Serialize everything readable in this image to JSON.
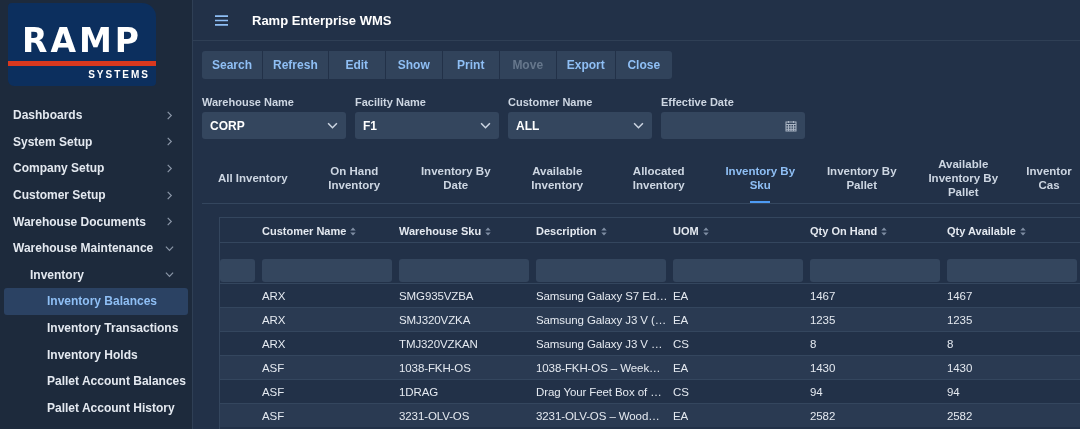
{
  "logo": {
    "name": "RAMP",
    "tagline": "SYSTEMS"
  },
  "sidebar": {
    "items": [
      {
        "label": "Dashboards",
        "expanded": false,
        "selected": false
      },
      {
        "label": "System Setup",
        "expanded": false,
        "selected": false
      },
      {
        "label": "Company Setup",
        "expanded": false,
        "selected": false
      },
      {
        "label": "Customer Setup",
        "expanded": false,
        "selected": false
      },
      {
        "label": "Warehouse Documents",
        "expanded": false,
        "selected": false
      },
      {
        "label": "Warehouse Maintenance",
        "expanded": true,
        "selected": false,
        "children": [
          {
            "label": "Inventory",
            "expanded": true,
            "selected": false,
            "children": [
              {
                "label": "Inventory Balances",
                "selected": true
              },
              {
                "label": "Inventory Transactions",
                "selected": false
              },
              {
                "label": "Inventory Holds",
                "selected": false
              },
              {
                "label": "Pallet Account Balances",
                "selected": false
              },
              {
                "label": "Pallet Account History",
                "selected": false
              }
            ]
          }
        ]
      }
    ]
  },
  "header": {
    "title": "Ramp Enterprise WMS"
  },
  "toolbar": [
    {
      "label": "Search",
      "disabled": false
    },
    {
      "label": "Refresh",
      "disabled": false
    },
    {
      "label": "Edit",
      "disabled": false
    },
    {
      "label": "Show",
      "disabled": false
    },
    {
      "label": "Print",
      "disabled": false
    },
    {
      "label": "Move",
      "disabled": true
    },
    {
      "label": "Export",
      "disabled": false
    },
    {
      "label": "Close",
      "disabled": false
    }
  ],
  "filters": [
    {
      "label": "Warehouse Name",
      "value": "CORP",
      "kind": "select"
    },
    {
      "label": "Facility Name",
      "value": "F1",
      "kind": "select"
    },
    {
      "label": "Customer Name",
      "value": "ALL",
      "kind": "select"
    },
    {
      "label": "Effective Date",
      "kind": "date"
    }
  ],
  "tabs": [
    {
      "label": "All Inventory",
      "selected": false
    },
    {
      "label": "On Hand Inventory",
      "selected": false
    },
    {
      "label": "Inventory By Date",
      "selected": false
    },
    {
      "label": "Available Inventory",
      "selected": false
    },
    {
      "label": "Allocated Inventory",
      "selected": false
    },
    {
      "label": "Inventory By Sku",
      "selected": true
    },
    {
      "label": "Inventory By Pallet",
      "selected": false
    },
    {
      "label": "Available Inventory By Pallet",
      "selected": false
    },
    {
      "label": "Inventor Cas",
      "selected": false
    }
  ],
  "table": {
    "columns": [
      "",
      "Customer Name",
      "Warehouse Sku",
      "Description",
      "UOM",
      "Qty On Hand",
      "Qty Available",
      ""
    ],
    "rows": [
      [
        "",
        "ARX",
        "SMG935VZBA",
        "Samsung Galaxy S7 Ed…",
        "EA",
        "1467",
        "1467",
        ""
      ],
      [
        "",
        "ARX",
        "SMJ320VZKA",
        "Samsung Galaxy J3 V (…",
        "EA",
        "1235",
        "1235",
        ""
      ],
      [
        "",
        "ARX",
        "TMJ320VZKAN",
        "Samsung Galaxy J3 V …",
        "CS",
        "8",
        "8",
        ""
      ],
      [
        "",
        "ASF",
        "1038-FKH-OS",
        "1038-FKH-OS – Week…",
        "EA",
        "1430",
        "1430",
        ""
      ],
      [
        "",
        "ASF",
        "1DRAG",
        "Drag Your Feet Box of …",
        "CS",
        "94",
        "94",
        ""
      ],
      [
        "",
        "ASF",
        "3231-OLV-OS",
        "3231-OLV-OS – Wood…",
        "EA",
        "2582",
        "2582",
        ""
      ]
    ]
  }
}
